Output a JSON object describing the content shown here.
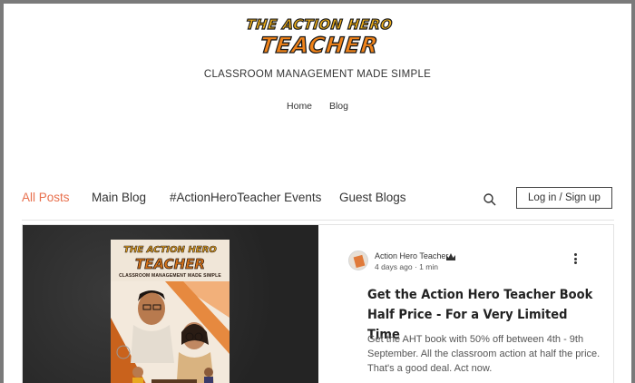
{
  "site": {
    "logo_line1": "THE ACTION HERO",
    "logo_line2": "TEACHER",
    "tagline": "CLASSROOM MANAGEMENT MADE SIMPLE",
    "nav": [
      "Home",
      "Blog"
    ]
  },
  "blog": {
    "categories": [
      "All Posts",
      "Main Blog",
      "#ActionHeroTeacher Events",
      "Guest Blogs"
    ],
    "active_category": "All Posts",
    "login_label": "Log in / Sign up"
  },
  "post": {
    "author": "Action Hero Teacher",
    "date": "4 days ago",
    "read_time": "1 min",
    "title": "Get the Action Hero Teacher Book Half Price - For a Very Limited Time",
    "excerpt": "Get the AHT book with 50% off between 4th - 9th September. All the classroom action at half the price. That's a good deal. Act now.",
    "cover": {
      "line1": "THE ACTION HERO",
      "line2": "TEACHER",
      "subtitle": "CLASSROOM MANAGEMENT MADE SIMPLE"
    }
  },
  "colors": {
    "accent": "#e86f4c",
    "logo_orange": "#f0831a",
    "logo_yellow": "#f3b21a"
  },
  "icons": {
    "search": "search-icon",
    "more": "more-options-icon",
    "crown": "crown-icon"
  }
}
